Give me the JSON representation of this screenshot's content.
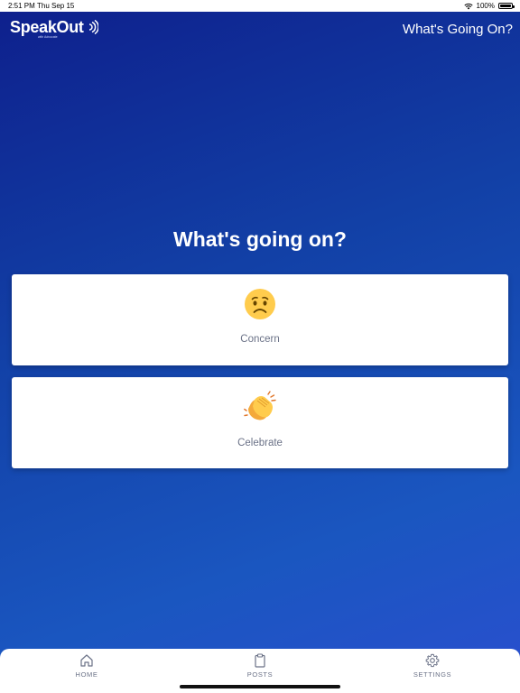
{
  "status_bar": {
    "time": "2:51 PM",
    "date": "Thu Sep 15",
    "battery": "100%"
  },
  "header": {
    "logo_text": "SpeakOut",
    "logo_subtext": "with Advocate",
    "title": "What's Going On?"
  },
  "main": {
    "title": "What's going on?",
    "options": [
      {
        "label": "Concern",
        "icon": "worried-face-emoji"
      },
      {
        "label": "Celebrate",
        "icon": "clapping-hands-emoji"
      }
    ]
  },
  "bottom_nav": {
    "items": [
      {
        "label": "HOME",
        "icon": "home-icon"
      },
      {
        "label": "POSTS",
        "icon": "clipboard-icon"
      },
      {
        "label": "SETTINGS",
        "icon": "gear-icon"
      }
    ]
  },
  "colors": {
    "background_top": "#0e1f8c",
    "background_bottom": "#2a4fcf",
    "card": "#ffffff",
    "label_gray": "#6b7287"
  }
}
